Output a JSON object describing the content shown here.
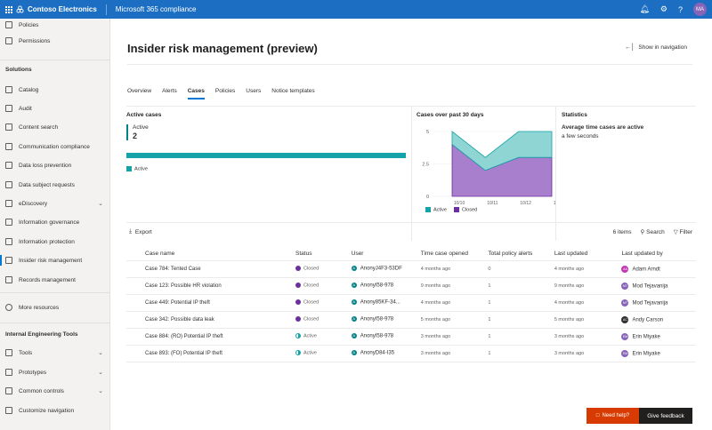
{
  "topbar": {
    "brand": "Contoso Electronics",
    "app": "Microsoft 365 compliance",
    "avatar_initials": "MA",
    "icons": [
      "waffle-icon",
      "bell-icon",
      "gear-icon",
      "help-icon"
    ]
  },
  "sidebar": {
    "items_top": [
      {
        "label": "Policies",
        "icon": "policies-icon"
      },
      {
        "label": "Permissions",
        "icon": "permissions-icon"
      }
    ],
    "section_solutions": "Solutions",
    "solutions": [
      {
        "label": "Catalog",
        "icon": "catalog-icon"
      },
      {
        "label": "Audit",
        "icon": "audit-icon"
      },
      {
        "label": "Content search",
        "icon": "search-icon"
      },
      {
        "label": "Communication compliance",
        "icon": "communication-icon"
      },
      {
        "label": "Data loss prevention",
        "icon": "dlp-icon"
      },
      {
        "label": "Data subject requests",
        "icon": "dsr-icon"
      },
      {
        "label": "eDiscovery",
        "icon": "ediscovery-icon",
        "chevron": true
      },
      {
        "label": "Information governance",
        "icon": "governance-icon"
      },
      {
        "label": "Information protection",
        "icon": "protection-icon"
      },
      {
        "label": "Insider risk management",
        "icon": "insider-risk-icon",
        "active": true
      },
      {
        "label": "Records management",
        "icon": "records-icon"
      }
    ],
    "more_resources": "More resources",
    "section_internal": "Internal Engineering Tools",
    "internal": [
      {
        "label": "Tools",
        "icon": "tools-icon",
        "chevron": true
      },
      {
        "label": "Prototypes",
        "icon": "prototypes-icon",
        "chevron": true
      },
      {
        "label": "Common controls",
        "icon": "controls-icon",
        "chevron": true
      },
      {
        "label": "Customize navigation",
        "icon": "edit-icon"
      }
    ]
  },
  "page": {
    "title": "Insider risk management (preview)",
    "show_in_navigation": "Show in navigation",
    "tabs": [
      "Overview",
      "Alerts",
      "Cases",
      "Policies",
      "Users",
      "Notice templates"
    ],
    "active_tab": "Cases"
  },
  "active_cases": {
    "title": "Active cases",
    "label": "Active",
    "count": "2",
    "legend": "Active",
    "color": "#13a3a8"
  },
  "cases_chart": {
    "title": "Cases over past 30 days",
    "legend": [
      "Active",
      "Closed"
    ]
  },
  "chart_data": {
    "type": "area",
    "title": "Cases over past 30 days",
    "x": [
      "10/10",
      "10/11",
      "10/12",
      "10/13"
    ],
    "ylim": [
      0,
      5
    ],
    "yticks": [
      "5",
      "2.5",
      "0"
    ],
    "series": [
      {
        "name": "Closed",
        "values": [
          4,
          2,
          3,
          3
        ],
        "color": "#a77fcd"
      },
      {
        "name": "Active",
        "values": [
          1,
          1,
          2,
          2
        ],
        "color": "#8fd5d4"
      }
    ]
  },
  "statistics": {
    "title": "Statistics",
    "subtitle": "Average time cases are active",
    "value": "a few seconds"
  },
  "toolbar": {
    "export": "Export",
    "items_count": "6 items",
    "search": "Search",
    "filter": "Filter"
  },
  "table": {
    "headers": [
      "Case name",
      "Status",
      "User",
      "Time case opened",
      "Total policy alerts",
      "Last updated",
      "Last updated by"
    ],
    "rows": [
      {
        "name": "Case 784: Tented Case",
        "status": "Closed",
        "user": "AnonyJ4F3-53DF",
        "opened": "4 months ago",
        "alerts": "0",
        "updated": "4 months ago",
        "by": "Adam Arndt",
        "by_initials": "AA",
        "by_color": "#c239b3"
      },
      {
        "name": "Case 123: Possible HR violation",
        "status": "Closed",
        "user": "AnonyI58-978",
        "opened": "9 months ago",
        "alerts": "1",
        "updated": "9 months ago",
        "by": "Mod Tejavanija",
        "by_initials": "MT",
        "by_color": "#8764b8"
      },
      {
        "name": "Case 449: Potential IP theft",
        "status": "Closed",
        "user": "Anony85KF-34...",
        "opened": "4 months ago",
        "alerts": "1",
        "updated": "4 months ago",
        "by": "Mod Tejavanija",
        "by_initials": "MT",
        "by_color": "#8764b8"
      },
      {
        "name": "Case 342: Possible data leak",
        "status": "Closed",
        "user": "AnonyI58-978",
        "opened": "5 months ago",
        "alerts": "1",
        "updated": "5 months ago",
        "by": "Andy Carson",
        "by_initials": "AC",
        "by_color": "#323130"
      },
      {
        "name": "Case 884: (RO) Potential IP theft",
        "status": "Active",
        "user": "AnonyI58-978",
        "opened": "3 months ago",
        "alerts": "1",
        "updated": "3 months ago",
        "by": "Erin Miyake",
        "by_initials": "EM",
        "by_color": "#8764b8"
      },
      {
        "name": "Case 893: (FO) Potential IP theft",
        "status": "Active",
        "user": "AnonyD84-I35",
        "opened": "3 months ago",
        "alerts": "1",
        "updated": "3 months ago",
        "by": "Erin Miyake",
        "by_initials": "EM",
        "by_color": "#8764b8"
      }
    ]
  },
  "footer": {
    "need_help": "Need help?",
    "give_feedback": "Give feedback"
  },
  "colors": {
    "topbar": "#1b6ec2",
    "accent": "#0078d4",
    "closed": "#6b2fa0",
    "active": "#13a3a8",
    "help": "#d83b01"
  }
}
